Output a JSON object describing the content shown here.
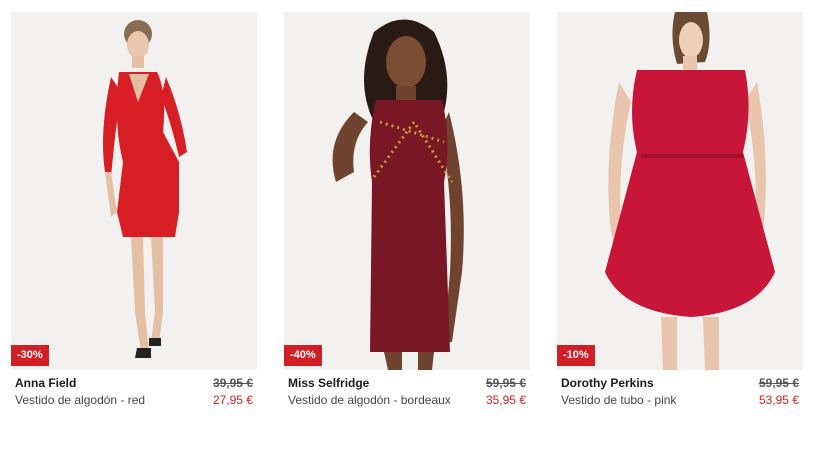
{
  "colors": {
    "badge_bg": "#d11f26",
    "sale_price": "#d11f26"
  },
  "products": [
    {
      "badge": "-30%",
      "brand": "Anna Field",
      "description": "Vestido de algodón - red",
      "old_price": "39,95 €",
      "price": "27,95 €",
      "dress_color": "#d71e25"
    },
    {
      "badge": "-40%",
      "brand": "Miss Selfridge",
      "description": "Vestido de algodón - bordeaux",
      "old_price": "59,95 €",
      "price": "35,95 €",
      "dress_color": "#7a1724"
    },
    {
      "badge": "-10%",
      "brand": "Dorothy Perkins",
      "description": "Vestido de tubo - pink",
      "old_price": "59,95 €",
      "price": "53,95 €",
      "dress_color": "#c8153a"
    }
  ]
}
